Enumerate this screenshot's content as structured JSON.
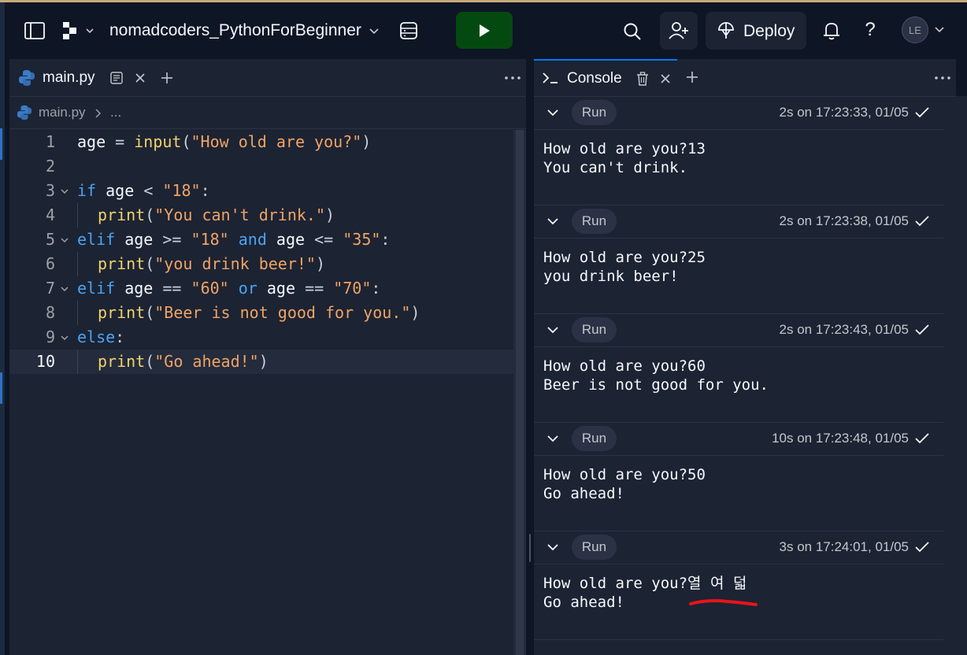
{
  "header": {
    "repl_name": "nomadcoders_PythonForBeginner",
    "deploy_label": "Deploy",
    "help_label": "?",
    "avatar_initials": "LE",
    "accent_color": "#0079f2",
    "run_color": "#044a10"
  },
  "editor": {
    "tab_label": "main.py",
    "breadcrumb_file": "main.py",
    "breadcrumb_more": "...",
    "active_line": 10,
    "lines": [
      {
        "num": "1",
        "tokens": [
          {
            "t": "age",
            "c": "id"
          },
          {
            "t": " = ",
            "c": "op"
          },
          {
            "t": "input",
            "c": "fn"
          },
          {
            "t": "(",
            "c": "op"
          },
          {
            "t": "\"How old are you?\"",
            "c": "str"
          },
          {
            "t": ")",
            "c": "op"
          }
        ]
      },
      {
        "num": "2",
        "tokens": []
      },
      {
        "num": "3",
        "fold": true,
        "tokens": [
          {
            "t": "if",
            "c": "kw"
          },
          {
            "t": " age ",
            "c": "id"
          },
          {
            "t": "<",
            "c": "op"
          },
          {
            "t": " ",
            "c": "op"
          },
          {
            "t": "\"18\"",
            "c": "str"
          },
          {
            "t": ":",
            "c": "op"
          }
        ]
      },
      {
        "num": "4",
        "indent": true,
        "tokens": [
          {
            "t": "print",
            "c": "fn"
          },
          {
            "t": "(",
            "c": "op"
          },
          {
            "t": "\"You can't drink.\"",
            "c": "str"
          },
          {
            "t": ")",
            "c": "op"
          }
        ]
      },
      {
        "num": "5",
        "fold": true,
        "tokens": [
          {
            "t": "elif",
            "c": "kw"
          },
          {
            "t": " age ",
            "c": "id"
          },
          {
            "t": ">=",
            "c": "op"
          },
          {
            "t": " ",
            "c": "op"
          },
          {
            "t": "\"18\"",
            "c": "str"
          },
          {
            "t": " ",
            "c": "op"
          },
          {
            "t": "and",
            "c": "kw"
          },
          {
            "t": " age ",
            "c": "id"
          },
          {
            "t": "<=",
            "c": "op"
          },
          {
            "t": " ",
            "c": "op"
          },
          {
            "t": "\"35\"",
            "c": "str"
          },
          {
            "t": ":",
            "c": "op"
          }
        ]
      },
      {
        "num": "6",
        "indent": true,
        "tokens": [
          {
            "t": "print",
            "c": "fn"
          },
          {
            "t": "(",
            "c": "op"
          },
          {
            "t": "\"you drink beer!\"",
            "c": "str"
          },
          {
            "t": ")",
            "c": "op"
          }
        ]
      },
      {
        "num": "7",
        "fold": true,
        "tokens": [
          {
            "t": "elif",
            "c": "kw"
          },
          {
            "t": " age ",
            "c": "id"
          },
          {
            "t": "==",
            "c": "op"
          },
          {
            "t": " ",
            "c": "op"
          },
          {
            "t": "\"60\"",
            "c": "str"
          },
          {
            "t": " ",
            "c": "op"
          },
          {
            "t": "or",
            "c": "kw"
          },
          {
            "t": " age ",
            "c": "id"
          },
          {
            "t": "==",
            "c": "op"
          },
          {
            "t": " ",
            "c": "op"
          },
          {
            "t": "\"70\"",
            "c": "str"
          },
          {
            "t": ":",
            "c": "op"
          }
        ]
      },
      {
        "num": "8",
        "indent": true,
        "tokens": [
          {
            "t": "print",
            "c": "fn"
          },
          {
            "t": "(",
            "c": "op"
          },
          {
            "t": "\"Beer is not good for you.\"",
            "c": "str"
          },
          {
            "t": ")",
            "c": "op"
          }
        ]
      },
      {
        "num": "9",
        "fold": true,
        "tokens": [
          {
            "t": "else",
            "c": "kw"
          },
          {
            "t": ":",
            "c": "op"
          }
        ]
      },
      {
        "num": "10",
        "indent": true,
        "tokens": [
          {
            "t": "print",
            "c": "fn"
          },
          {
            "t": "(",
            "c": "op"
          },
          {
            "t": "\"Go ahead!\"",
            "c": "str"
          },
          {
            "t": ")",
            "c": "op"
          }
        ]
      }
    ]
  },
  "console": {
    "tab_label": "Console",
    "entries": [
      {
        "run_label": "Run",
        "time": "2s on 17:23:33, 01/05",
        "output": "How old are you?13\nYou can't drink."
      },
      {
        "run_label": "Run",
        "time": "2s on 17:23:38, 01/05",
        "output": "How old are you?25\nyou drink beer!"
      },
      {
        "run_label": "Run",
        "time": "2s on 17:23:43, 01/05",
        "output": "How old are you?60\nBeer is not good for you."
      },
      {
        "run_label": "Run",
        "time": "10s on 17:23:48, 01/05",
        "output": "How old are you?50\nGo ahead!"
      },
      {
        "run_label": "Run",
        "time": "3s on 17:24:01, 01/05",
        "output": "How old are you?열 여 덟\nGo ahead!"
      }
    ]
  }
}
